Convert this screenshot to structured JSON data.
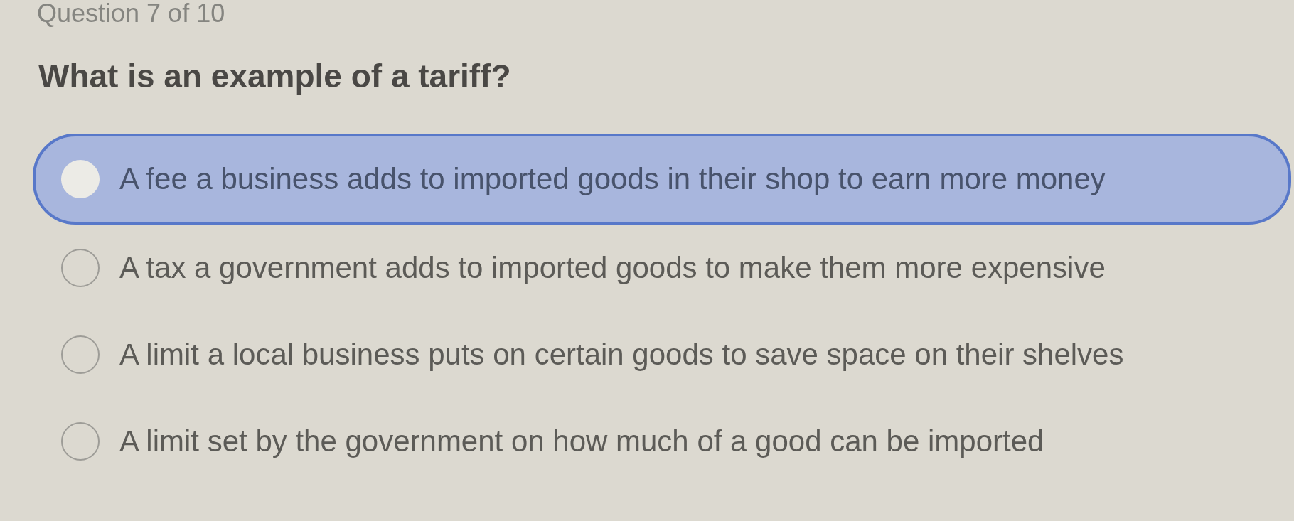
{
  "header": {
    "progress": "Question 7 of 10"
  },
  "question": {
    "text": "What is an example of a tariff?"
  },
  "options": [
    {
      "text": "A fee a business adds to imported goods in their shop to earn more money",
      "selected": true
    },
    {
      "text": "A tax a government adds to imported goods to make them more expensive",
      "selected": false
    },
    {
      "text": "A limit a local business puts on certain goods to save space on their shelves",
      "selected": false
    },
    {
      "text": "A limit set by the government on how much of a good can be imported",
      "selected": false
    }
  ]
}
